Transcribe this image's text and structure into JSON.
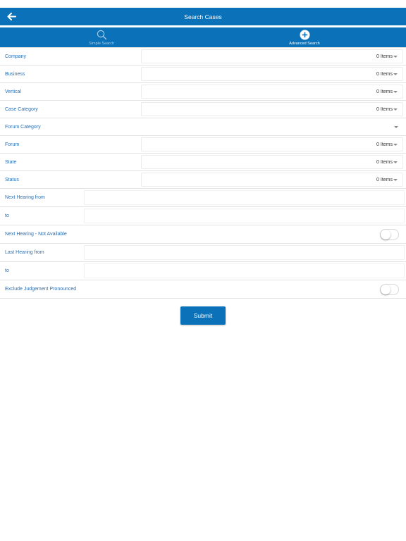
{
  "colors": {
    "primary": "#0b71b8",
    "label": "#2a6fb3"
  },
  "header": {
    "title": "Search Cases",
    "back_icon": "arrow-left-icon"
  },
  "tabs": [
    {
      "label": "Simple Search",
      "icon": "search-icon",
      "active": false
    },
    {
      "label": "Advanced Search",
      "icon": "plus-circle-icon",
      "active": true
    }
  ],
  "fields": {
    "company": {
      "label": "Company",
      "value": "0 Items"
    },
    "business": {
      "label": "Business",
      "value": "0 Items"
    },
    "vertical": {
      "label": "Vertical",
      "value": "0 Items"
    },
    "case_category": {
      "label": "Case Category",
      "value": "0 Items"
    },
    "forum_category": {
      "label": "Forum Category"
    },
    "forum": {
      "label": "Forum",
      "value": "0 Items"
    },
    "state": {
      "label": "State",
      "value": "0 Items"
    },
    "status": {
      "label": "Status",
      "value": "0 Items"
    },
    "next_hearing_from": {
      "label": "Next Hearing from",
      "value": ""
    },
    "next_hearing_to": {
      "label": "to",
      "value": ""
    },
    "next_hearing_na": {
      "label": "Next Hearing - Not Available",
      "on": false
    },
    "last_hearing_from": {
      "label": "Last Hearing from",
      "value": ""
    },
    "last_hearing_to": {
      "label": "to",
      "value": ""
    },
    "exclude_judgement": {
      "label": "Exclude Judgement Pronounced",
      "on": false
    }
  },
  "submit_label": "Submit"
}
